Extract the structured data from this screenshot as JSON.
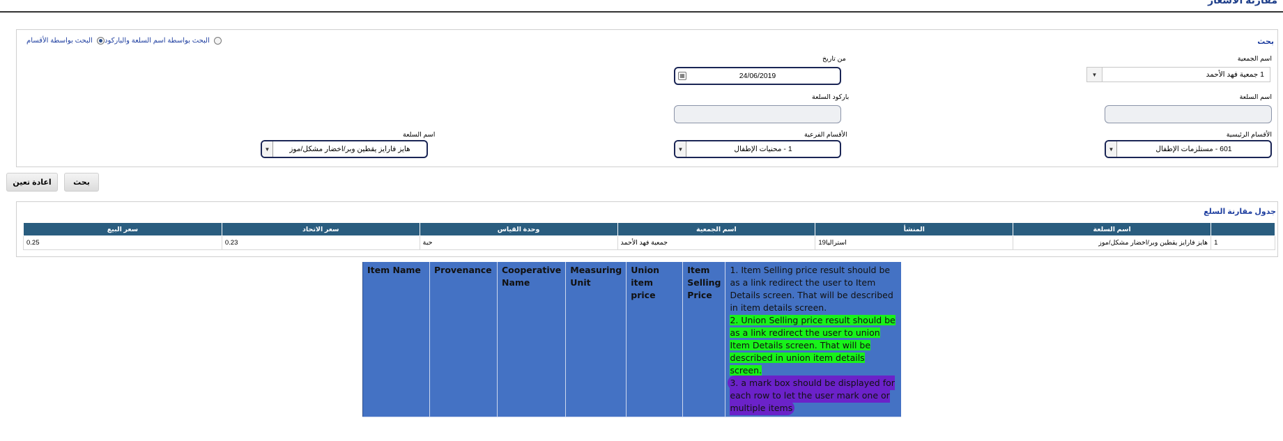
{
  "page": {
    "title": "مقارنة الأسعار"
  },
  "search": {
    "section_title": "بحث",
    "radio_by_name_barcode": "البحث بواسطة اسم السلعة والباركود",
    "radio_by_category": "البحث بواسطة الأقسام",
    "cooperative_label": "اسم الجمعية",
    "cooperative_value": "1 جمعية فهد الأحمد",
    "from_date_label": "من تاريخ",
    "from_date_value": "24/06/2019",
    "item_name_label": "اسم السلعة",
    "item_name_value": "",
    "barcode_label": "باركود السلعة",
    "barcode_value": "",
    "main_category_label": "الأقسام الرئيسية",
    "main_category_value": "601 - مستلزمات الإطفال",
    "sub_category_label": "الأقسام الفرعية",
    "sub_category_value": "1 - محنيات الإطفال",
    "item_select_label": "اسم السلعة",
    "item_select_value": "هايز فارايز يقطين وبر/اخضار مشكل/موز"
  },
  "buttons": {
    "search": "بحث",
    "reset": "اعادة تعين"
  },
  "grid": {
    "title": "جدول مقارنة السلع",
    "columns": [
      "",
      "اسم السلعة",
      "المنشأ",
      "اسم الجمعية",
      "وحدة القياس",
      "سعر الاتحاد",
      "سعر البيع"
    ],
    "rows": [
      [
        "1",
        "هايز فارايز يقطين وبر/اخضار مشكل/موز",
        "استراليا19",
        "جمعية فهد الأحمد",
        "حبة",
        "0.23",
        "0.25"
      ]
    ]
  },
  "spec": {
    "headers": [
      "Item Name",
      "Provenance",
      "Cooperative Name",
      "Measuring Unit",
      "Union item price",
      "Item Selling Price"
    ],
    "notes": [
      "1. Item Selling price result should be as a link redirect the user to Item Details screen. That will be described in item details screen.",
      "2. Union Selling price result should be as a link redirect the user to union Item Details screen. That will be described in union item details screen.",
      "3. a mark box should be displayed for each row to let the user mark one or multiple items"
    ]
  },
  "colors": {
    "header_blue": "#2a5d7f",
    "spec_blue": "#4472c4",
    "highlight_green": "#18f21a",
    "highlight_purple": "#6b22c9"
  }
}
